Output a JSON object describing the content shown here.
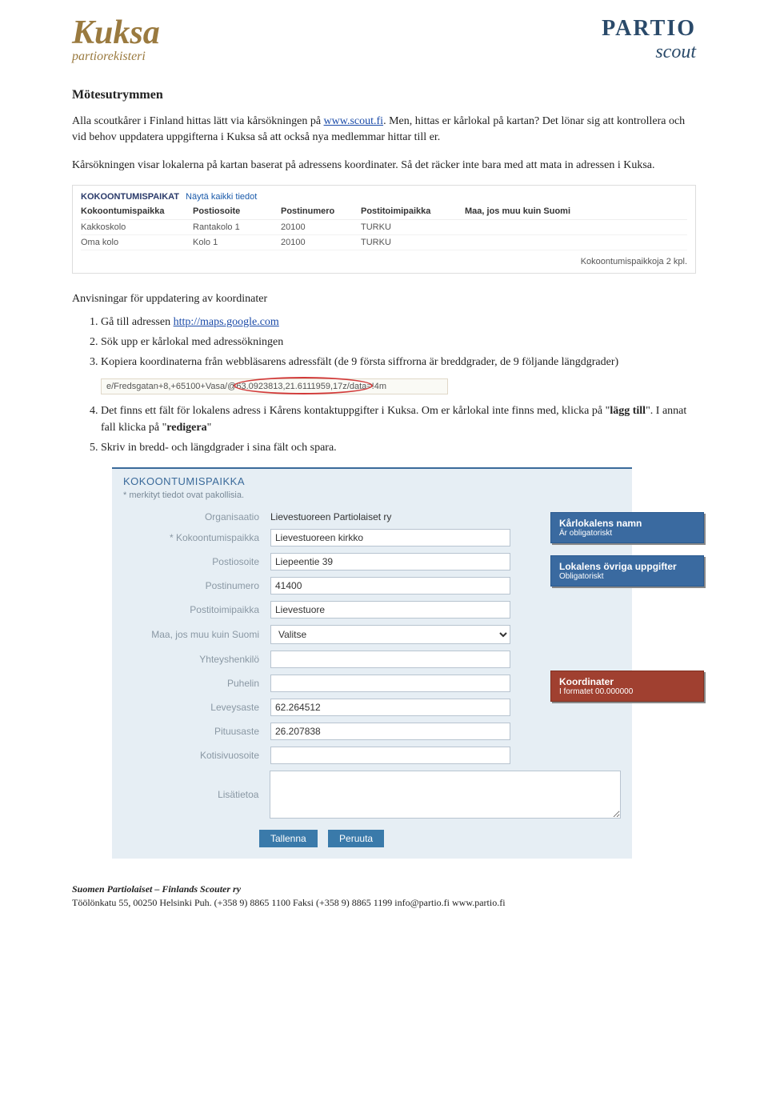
{
  "header": {
    "logo_left_main": "Kuksa",
    "logo_left_sub": "partiorekisteri",
    "logo_right_top": "PARTIO",
    "logo_right_sub": "scout"
  },
  "title": "Mötesutrymmen",
  "paragraphs": {
    "p1a": "Alla scoutkårer i Finland hittas lätt via kårsökningen på ",
    "p1link": "www.scout.fi",
    "p1b": ". Men, hittas er kårlokal på kartan? Det lönar sig att kontrollera och vid behov uppdatera uppgifterna i Kuksa så att också nya medlemmar hittar till er.",
    "p2": "Kårsökningen visar lokalerna på kartan baserat på adressens koordinater. Så det räcker inte bara med att mata in adressen i Kuksa."
  },
  "shot1": {
    "heading": "KOKOONTUMISPAIKAT",
    "link": "Näytä kaikki tiedot",
    "cols": [
      "Kokoontumispaikka",
      "Postiosoite",
      "Postinumero",
      "Postitoimipaikka",
      "Maa, jos muu kuin Suomi"
    ],
    "rows": [
      [
        "Kakkoskolo",
        "Rantakolo 1",
        "20100",
        "TURKU",
        ""
      ],
      [
        "Oma kolo",
        "Kolo 1",
        "20100",
        "TURKU",
        ""
      ]
    ],
    "footer": "Kokoontumispaikkoja 2 kpl."
  },
  "subhead": "Anvisningar för uppdatering av koordinater",
  "steps": {
    "s1a": "Gå till adressen ",
    "s1link": "http://maps.google.com",
    "s2": "Sök upp er kårlokal med adressökningen",
    "s3": "Kopiera koordinaterna från webbläsarens adressfält (de 9 första siffrorna är breddgrader, de 9 följande längdgrader)",
    "urlbar": "e/Fredsgatan+8,+65100+Vasa/@63.0923813,21.6111959,17z/data=!4m",
    "s4a": "Det finns ett fält för lokalens adress i Kårens kontaktuppgifter i Kuksa. Om er kårlokal inte finns med, klicka på \"",
    "s4b": "lägg till",
    "s4c": "\". I annat fall klicka på \"",
    "s4d": "redigera",
    "s4e": "\"",
    "s5": "Skriv in bredd- och längdgrader i sina fält och spara."
  },
  "form": {
    "title": "KOKOONTUMISPAIKKA",
    "mandatory": "* merkityt tiedot ovat pakollisia.",
    "labels": {
      "org": "Organisaatio",
      "place": "* Kokoontumispaikka",
      "street": "Postiosoite",
      "zip": "Postinumero",
      "city": "Postitoimipaikka",
      "country": "Maa, jos muu kuin Suomi",
      "contact": "Yhteyshenkilö",
      "phone": "Puhelin",
      "lat": "Leveysaste",
      "lon": "Pituusaste",
      "web": "Kotisivuosoite",
      "info": "Lisätietoa"
    },
    "values": {
      "org": "Lievestuoreen Partiolaiset ry",
      "place": "Lievestuoreen kirkko",
      "street": "Liepeentie 39",
      "zip": "41400",
      "city": "Lievestuore",
      "country": "Valitse",
      "contact": "",
      "phone": "",
      "lat": "62.264512",
      "lon": "26.207838",
      "web": "",
      "info": ""
    },
    "buttons": {
      "save": "Tallenna",
      "cancel": "Peruuta"
    }
  },
  "callouts": {
    "c1t": "Kårlokalens namn",
    "c1s": "Är obligatoriskt",
    "c2t": "Lokalens övriga uppgifter",
    "c2s": "Obligatoriskt",
    "c3t": "Koordinater",
    "c3s": "I formatet 00.000000"
  },
  "footer": {
    "org": "Suomen Partiolaiset – Finlands Scouter ry",
    "addr": "Töölönkatu 55, 00250 Helsinki  Puh. (+358 9) 8865 1100  Faksi (+358 9) 8865 1199  info@partio.fi  www.partio.fi"
  }
}
